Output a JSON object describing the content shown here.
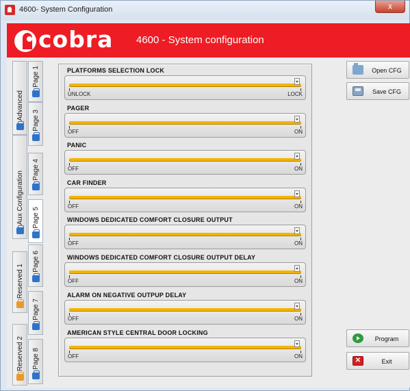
{
  "window": {
    "title": "4600- System Configuration",
    "close_label": "x"
  },
  "header": {
    "logo_text": "cobra",
    "title": "4600 - System configuration"
  },
  "outer_tabs": [
    {
      "label": "Advanced",
      "icon": "folder-icon"
    },
    {
      "label": "Aux Configuration",
      "icon": "folder-icon"
    },
    {
      "label": "Reserved 1",
      "icon": "folder-icon"
    },
    {
      "label": "Reserved 2",
      "icon": "folder-icon"
    }
  ],
  "page_tabs": [
    {
      "label": "Page 1"
    },
    {
      "label": "Page 3"
    },
    {
      "label": "Page 4"
    },
    {
      "label": "Page 5",
      "active": true
    },
    {
      "label": "Page 6"
    },
    {
      "label": "Page 7"
    },
    {
      "label": "Page 8"
    }
  ],
  "settings": [
    {
      "title": "PLATFORMS SELECTION LOCK",
      "low": "UNLOCK",
      "high": "LOCK",
      "level": 1.0
    },
    {
      "title": "PAGER",
      "low": "OFF",
      "high": "ON",
      "level": 1.0
    },
    {
      "title": "PANIC",
      "low": "OFF",
      "high": "ON",
      "level": 1.0
    },
    {
      "title": "CAR FINDER",
      "low": "OFF",
      "high": "ON",
      "level": 1.0
    },
    {
      "title": "WINDOWS DEDICATED COMFORT CLOSURE OUTPUT",
      "low": "OFF",
      "high": "ON",
      "level": 1.0
    },
    {
      "title": "WINDOWS DEDICATED COMFORT CLOSURE OUTPUT DELAY",
      "low": "OFF",
      "high": "ON",
      "level": 1.0
    },
    {
      "title": "ALARM ON NEGATIVE OUTPUP DELAY",
      "low": "OFF",
      "high": "ON",
      "level": 1.0
    },
    {
      "title": "AMERICAN STYLE CENTRAL DOOR LOCKING",
      "low": "OFF",
      "high": "ON",
      "level": 1.0
    }
  ],
  "buttons": {
    "open_cfg": "Open CFG",
    "save_cfg": "Save CFG",
    "program": "Program",
    "exit": "Exit"
  },
  "colors": {
    "header_red": "#ee1c24",
    "track_yellow": "#f4b400"
  }
}
